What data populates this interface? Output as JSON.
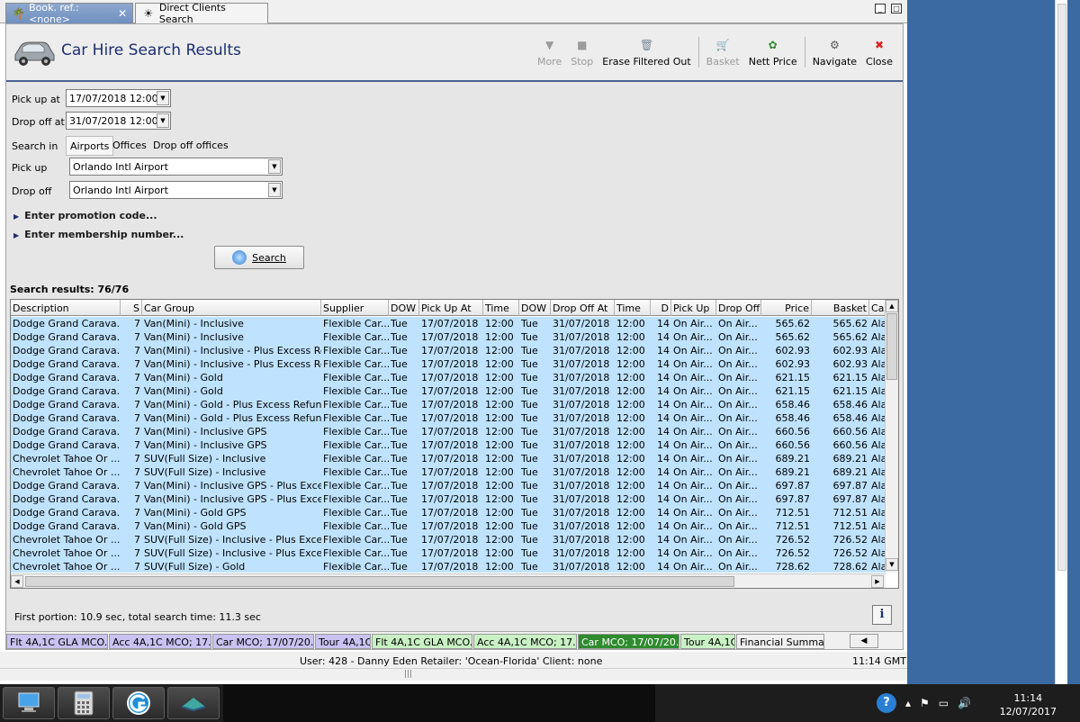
{
  "tabs": [
    {
      "label": "Book. ref.: <none>",
      "icon": "palm-tree-icon"
    },
    {
      "label": "Direct Clients Search",
      "icon": "sun-people-icon"
    }
  ],
  "header": {
    "title": "Car Hire Search Results"
  },
  "toolbar": [
    {
      "label": "More",
      "icon": "down-arrow-icon",
      "enabled": false
    },
    {
      "label": "Stop",
      "icon": "stop-icon",
      "enabled": false
    },
    {
      "label": "Erase Filtered Out",
      "icon": "erase-bin-icon",
      "enabled": true
    },
    {
      "label": "Basket",
      "icon": "basket-icon",
      "enabled": false
    },
    {
      "label": "Nett Price",
      "icon": "nett-price-icon",
      "enabled": true
    },
    {
      "label": "Navigate",
      "icon": "navigate-icon",
      "enabled": true
    },
    {
      "label": "Close",
      "icon": "close-icon",
      "enabled": true
    }
  ],
  "form": {
    "pickup_at_label": "Pick up at",
    "pickup_at_value": "17/07/2018 12:00",
    "dropoff_at_label": "Drop off at",
    "dropoff_at_value": "31/07/2018 12:00",
    "search_in_label": "Search in",
    "search_in_options": [
      "Airports",
      "Offices",
      "Drop off offices"
    ],
    "pickup_label": "Pick up",
    "pickup_value": "Orlando Intl Airport",
    "dropoff_label": "Drop off",
    "dropoff_value": "Orlando Intl Airport",
    "promo_label": "Enter promotion code...",
    "membership_label": "Enter membership number...",
    "search_button": "Search"
  },
  "results": {
    "count_label": "Search results: 76/76",
    "columns": [
      "Description",
      "S",
      "Car Group",
      "Supplier",
      "DOW",
      "Pick Up At",
      "Time",
      "DOW",
      "Drop Off At",
      "Time",
      "D",
      "Pick Up",
      "Drop Off",
      "Price",
      "Basket",
      "Ca"
    ],
    "rows": [
      [
        "Dodge Grand Carava...",
        "7",
        "Van(Mini) - Inclusive",
        "Flexible Car...",
        "Tue",
        "17/07/2018",
        "12:00",
        "Tue",
        "31/07/2018",
        "12:00",
        "14",
        "On Air...",
        "On Air...",
        "565.62",
        "565.62",
        "Ala"
      ],
      [
        "Dodge Grand Carava...",
        "7",
        "Van(Mini) - Inclusive",
        "Flexible Car...",
        "Tue",
        "17/07/2018",
        "12:00",
        "Tue",
        "31/07/2018",
        "12:00",
        "14",
        "On Air...",
        "On Air...",
        "565.62",
        "565.62",
        "Ala"
      ],
      [
        "Dodge Grand Carava...",
        "7",
        "Van(Mini) - Inclusive - Plus Excess Ref...",
        "Flexible Car...",
        "Tue",
        "17/07/2018",
        "12:00",
        "Tue",
        "31/07/2018",
        "12:00",
        "14",
        "On Air...",
        "On Air...",
        "602.93",
        "602.93",
        "Ala"
      ],
      [
        "Dodge Grand Carava...",
        "7",
        "Van(Mini) - Inclusive - Plus Excess Ref...",
        "Flexible Car...",
        "Tue",
        "17/07/2018",
        "12:00",
        "Tue",
        "31/07/2018",
        "12:00",
        "14",
        "On Air...",
        "On Air...",
        "602.93",
        "602.93",
        "Ala"
      ],
      [
        "Dodge Grand Carava...",
        "7",
        "Van(Mini) - Gold",
        "Flexible Car...",
        "Tue",
        "17/07/2018",
        "12:00",
        "Tue",
        "31/07/2018",
        "12:00",
        "14",
        "On Air...",
        "On Air...",
        "621.15",
        "621.15",
        "Ala"
      ],
      [
        "Dodge Grand Carava...",
        "7",
        "Van(Mini) - Gold",
        "Flexible Car...",
        "Tue",
        "17/07/2018",
        "12:00",
        "Tue",
        "31/07/2018",
        "12:00",
        "14",
        "On Air...",
        "On Air...",
        "621.15",
        "621.15",
        "Ala"
      ],
      [
        "Dodge Grand Carava...",
        "7",
        "Van(Mini) - Gold - Plus Excess Refund",
        "Flexible Car...",
        "Tue",
        "17/07/2018",
        "12:00",
        "Tue",
        "31/07/2018",
        "12:00",
        "14",
        "On Air...",
        "On Air...",
        "658.46",
        "658.46",
        "Ala"
      ],
      [
        "Dodge Grand Carava...",
        "7",
        "Van(Mini) - Gold - Plus Excess Refund",
        "Flexible Car...",
        "Tue",
        "17/07/2018",
        "12:00",
        "Tue",
        "31/07/2018",
        "12:00",
        "14",
        "On Air...",
        "On Air...",
        "658.46",
        "658.46",
        "Ala"
      ],
      [
        "Dodge Grand Carava...",
        "7",
        "Van(Mini) - Inclusive GPS",
        "Flexible Car...",
        "Tue",
        "17/07/2018",
        "12:00",
        "Tue",
        "31/07/2018",
        "12:00",
        "14",
        "On Air...",
        "On Air...",
        "660.56",
        "660.56",
        "Ala"
      ],
      [
        "Dodge Grand Carava...",
        "7",
        "Van(Mini) - Inclusive GPS",
        "Flexible Car...",
        "Tue",
        "17/07/2018",
        "12:00",
        "Tue",
        "31/07/2018",
        "12:00",
        "14",
        "On Air...",
        "On Air...",
        "660.56",
        "660.56",
        "Ala"
      ],
      [
        "Chevrolet Tahoe Or ...",
        "7",
        "SUV(Full Size) - Inclusive",
        "Flexible Car...",
        "Tue",
        "17/07/2018",
        "12:00",
        "Tue",
        "31/07/2018",
        "12:00",
        "14",
        "On Air...",
        "On Air...",
        "689.21",
        "689.21",
        "Ala"
      ],
      [
        "Chevrolet Tahoe Or ...",
        "7",
        "SUV(Full Size) - Inclusive",
        "Flexible Car...",
        "Tue",
        "17/07/2018",
        "12:00",
        "Tue",
        "31/07/2018",
        "12:00",
        "14",
        "On Air...",
        "On Air...",
        "689.21",
        "689.21",
        "Ala"
      ],
      [
        "Dodge Grand Carava...",
        "7",
        "Van(Mini) - Inclusive GPS - Plus Excess...",
        "Flexible Car...",
        "Tue",
        "17/07/2018",
        "12:00",
        "Tue",
        "31/07/2018",
        "12:00",
        "14",
        "On Air...",
        "On Air...",
        "697.87",
        "697.87",
        "Ala"
      ],
      [
        "Dodge Grand Carava...",
        "7",
        "Van(Mini) - Inclusive GPS - Plus Exces...",
        "Flexible Car...",
        "Tue",
        "17/07/2018",
        "12:00",
        "Tue",
        "31/07/2018",
        "12:00",
        "14",
        "On Air...",
        "On Air...",
        "697.87",
        "697.87",
        "Ala"
      ],
      [
        "Dodge Grand Carava...",
        "7",
        "Van(Mini) - Gold GPS",
        "Flexible Car...",
        "Tue",
        "17/07/2018",
        "12:00",
        "Tue",
        "31/07/2018",
        "12:00",
        "14",
        "On Air...",
        "On Air...",
        "712.51",
        "712.51",
        "Ala"
      ],
      [
        "Dodge Grand Carava...",
        "7",
        "Van(Mini) - Gold GPS",
        "Flexible Car...",
        "Tue",
        "17/07/2018",
        "12:00",
        "Tue",
        "31/07/2018",
        "12:00",
        "14",
        "On Air...",
        "On Air...",
        "712.51",
        "712.51",
        "Ala"
      ],
      [
        "Chevrolet Tahoe Or ...",
        "7",
        "SUV(Full Size) - Inclusive - Plus Excess...",
        "Flexible Car...",
        "Tue",
        "17/07/2018",
        "12:00",
        "Tue",
        "31/07/2018",
        "12:00",
        "14",
        "On Air...",
        "On Air...",
        "726.52",
        "726.52",
        "Ala"
      ],
      [
        "Chevrolet Tahoe Or ...",
        "7",
        "SUV(Full Size) - Inclusive - Plus Excess...",
        "Flexible Car...",
        "Tue",
        "17/07/2018",
        "12:00",
        "Tue",
        "31/07/2018",
        "12:00",
        "14",
        "On Air...",
        "On Air...",
        "726.52",
        "726.52",
        "Ala"
      ],
      [
        "Chevrolet Tahoe Or ...",
        "7",
        "SUV(Full Size) - Gold",
        "Flexible Car...",
        "Tue",
        "17/07/2018",
        "12:00",
        "Tue",
        "31/07/2018",
        "12:00",
        "14",
        "On Air...",
        "On Air...",
        "728.62",
        "728.62",
        "Ala"
      ]
    ]
  },
  "timing_text": "First portion: 10.9 sec, total search time: 11.3 sec",
  "info_label": "i",
  "basket_tabs": [
    {
      "label": "Flt 4A,1C GLA MCO...",
      "color": "#c9c2f2"
    },
    {
      "label": "Acc 4A,1C MCO; 17...",
      "color": "#c9c2f2"
    },
    {
      "label": "Car MCO; 17/07/20...",
      "color": "#c9c2f2"
    },
    {
      "label": "Tour 4A,1C",
      "color": "#c9c2f2"
    },
    {
      "label": "Flt 4A,1C GLA MCO...",
      "color": "#c9f2c4"
    },
    {
      "label": "Acc 4A,1C MCO; 17...",
      "color": "#c9f2c4"
    },
    {
      "label": "Car MCO; 17/07/20...",
      "color": "#2e8b2e"
    },
    {
      "label": "Tour 4A,1C",
      "color": "#c9f2c4"
    },
    {
      "label": "Financial Summary",
      "color": "#f0f0f0"
    }
  ],
  "status": {
    "user_text": "User: 428 - Danny Eden     Retailer: 'Ocean-Florida'     Client: none",
    "gmt_text": "11:14 GMT"
  },
  "taskbar": {
    "apps": [
      "computer-icon",
      "calculator-icon",
      "browser-icon",
      "app-icon"
    ],
    "help": "?",
    "time": "11:14",
    "date": "12/07/2017"
  },
  "colors": {
    "accent": "#1c2f6f",
    "row_selected": "#bfe3ff",
    "header_line": "#4a6394"
  }
}
